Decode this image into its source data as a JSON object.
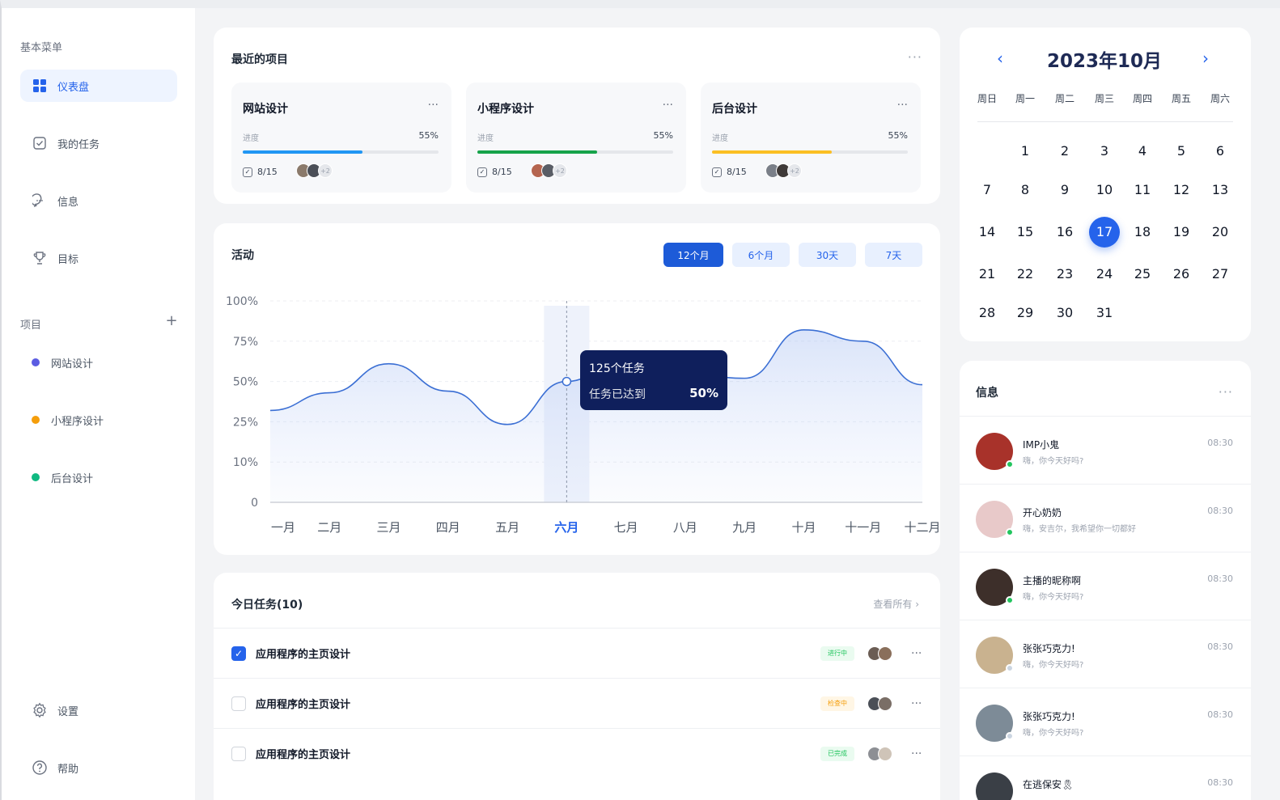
{
  "sidebar": {
    "basic_menu_title": "基本菜单",
    "items": [
      {
        "label": "仪表盘",
        "icon": "dashboard-icon"
      },
      {
        "label": "我的任务",
        "icon": "task-check-icon"
      },
      {
        "label": "信息",
        "icon": "message-icon"
      },
      {
        "label": "目标",
        "icon": "trophy-icon"
      }
    ],
    "projects_title": "项目",
    "add_symbol": "+",
    "projects": [
      {
        "label": "网站设计",
        "color": "#5b5ce2"
      },
      {
        "label": "小程序设计",
        "color": "#f59e0b"
      },
      {
        "label": "后台设计",
        "color": "#10b981"
      }
    ],
    "settings_label": "设置",
    "help_label": "帮助"
  },
  "recent": {
    "title": "最近的项目",
    "more": "···",
    "projects": [
      {
        "name": "网站设计",
        "progress_label": "进度",
        "progress_text": "55%",
        "progress": 0.61,
        "color": "#2196f3",
        "tasks": "8/15",
        "extra": "+2"
      },
      {
        "name": "小程序设计",
        "progress_label": "进度",
        "progress_text": "55%",
        "progress": 0.61,
        "color": "#16a34a",
        "tasks": "8/15",
        "extra": "+2"
      },
      {
        "name": "后台设计",
        "progress_label": "进度",
        "progress_text": "55%",
        "progress": 0.61,
        "color": "#fbbf24",
        "tasks": "8/15",
        "extra": "+2"
      }
    ]
  },
  "activity": {
    "title": "活动",
    "ranges": [
      "12个月",
      "6个月",
      "30天",
      "7天"
    ],
    "active_range": 0,
    "tooltip": {
      "title": "125个任务",
      "label": "任务已达到",
      "value": "50%"
    }
  },
  "chart_data": {
    "type": "area",
    "categories": [
      "一月",
      "二月",
      "三月",
      "四月",
      "五月",
      "六月",
      "七月",
      "八月",
      "九月",
      "十月",
      "十一月",
      "十二月"
    ],
    "y_ticks": [
      "0",
      "10%",
      "25%",
      "50%",
      "75%",
      "100%"
    ],
    "values": [
      32,
      43,
      61,
      44,
      24,
      50,
      66,
      55,
      52,
      82,
      75,
      48
    ],
    "highlight_index": 5,
    "colors": {
      "line": "#3b6fd4",
      "highlight": "#2563eb"
    },
    "grid": true
  },
  "today": {
    "title": "今日任务(10)",
    "view_all": "查看所有 ›",
    "tasks": [
      {
        "name": "应用程序的主页设计",
        "checked": true,
        "status": "进行中",
        "status_color": "#22c55e",
        "status_bg": "#eafbf0"
      },
      {
        "name": "应用程序的主页设计",
        "checked": false,
        "status": "检查中",
        "status_color": "#f59e0b",
        "status_bg": "#fff6e5"
      },
      {
        "name": "应用程序的主页设计",
        "checked": false,
        "status": "已完成",
        "status_color": "#22c55e",
        "status_bg": "#eafbf0"
      }
    ],
    "check_mark": "✓",
    "more": "···"
  },
  "calendar": {
    "title": "2023年10月",
    "prev": "‹",
    "next": "›",
    "weekdays": [
      "周日",
      "周一",
      "周二",
      "周三",
      "周四",
      "周五",
      "周六"
    ],
    "first_weekday": 1,
    "days_in_month": 31,
    "today": 17
  },
  "messages": {
    "title": "信息",
    "more": "···",
    "items": [
      {
        "name": "IMP小鬼",
        "text": "嗨，你今天好吗?",
        "time": "08:30",
        "online": true
      },
      {
        "name": "开心奶奶",
        "text": "嗨，安吉尔，我希望你一切都好",
        "time": "08:30",
        "online": true
      },
      {
        "name": "主播的昵称啊",
        "text": "嗨，你今天好吗?",
        "time": "08:30",
        "online": true
      },
      {
        "name": "张张巧克力!",
        "text": "嗨，你今天好吗?",
        "time": "08:30",
        "online": false
      },
      {
        "name": "张张巧克力!",
        "text": "嗨，你今天好吗?",
        "time": "08:30",
        "online": false
      },
      {
        "name": "在逃保安🎗",
        "text": "",
        "time": "08:30",
        "online": false
      }
    ]
  }
}
